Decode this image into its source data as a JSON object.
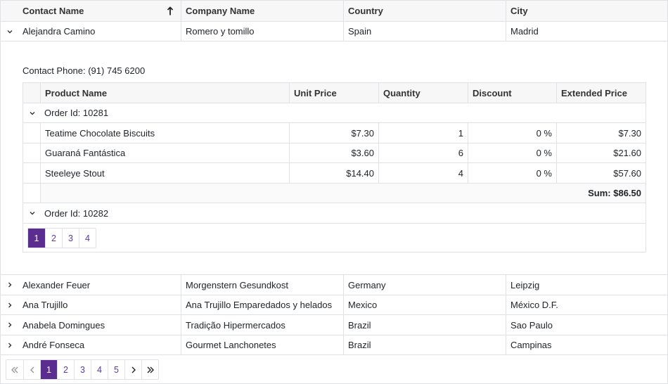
{
  "grid": {
    "columns": [
      "Contact Name",
      "Company Name",
      "Country",
      "City"
    ],
    "sort_icon": "arrow-up-icon",
    "expanded_row": {
      "contact": "Alejandra Camino",
      "company": "Romero y tomillo",
      "country": "Spain",
      "city": "Madrid",
      "detail": {
        "phone_label": "Contact Phone: (91) 745 6200",
        "columns": [
          "Product Name",
          "Unit Price",
          "Quantity",
          "Discount",
          "Extended Price"
        ],
        "groups": [
          {
            "label": "Order Id: 10281",
            "items": [
              {
                "product": "Teatime Chocolate Biscuits",
                "price": "$7.30",
                "qty": "1",
                "discount": "0 %",
                "ext": "$7.30"
              },
              {
                "product": "Guaraná Fantástica",
                "price": "$3.60",
                "qty": "6",
                "discount": "0 %",
                "ext": "$21.60"
              },
              {
                "product": "Steeleye Stout",
                "price": "$14.40",
                "qty": "4",
                "discount": "0 %",
                "ext": "$57.60"
              }
            ],
            "sum": "Sum: $86.50"
          },
          {
            "label": "Order Id: 10282"
          }
        ],
        "pager": {
          "pages": [
            "1",
            "2",
            "3",
            "4"
          ],
          "current": "1"
        }
      }
    },
    "rows": [
      {
        "contact": "Alexander Feuer",
        "company": "Morgenstern Gesundkost",
        "country": "Germany",
        "city": "Leipzig"
      },
      {
        "contact": "Ana Trujillo",
        "company": "Ana Trujillo Emparedados y helados",
        "country": "Mexico",
        "city": "México D.F."
      },
      {
        "contact": "Anabela Domingues",
        "company": "Tradição Hipermercados",
        "country": "Brazil",
        "city": "Sao Paulo"
      },
      {
        "contact": "André Fonseca",
        "company": "Gourmet Lanchonetes",
        "country": "Brazil",
        "city": "Campinas"
      }
    ],
    "pager": {
      "pages": [
        "1",
        "2",
        "3",
        "4",
        "5"
      ],
      "current": "1"
    }
  },
  "colors": {
    "accent": "#5c2d91",
    "border": "#dee2e6",
    "header_bg": "#f7f7f7"
  }
}
